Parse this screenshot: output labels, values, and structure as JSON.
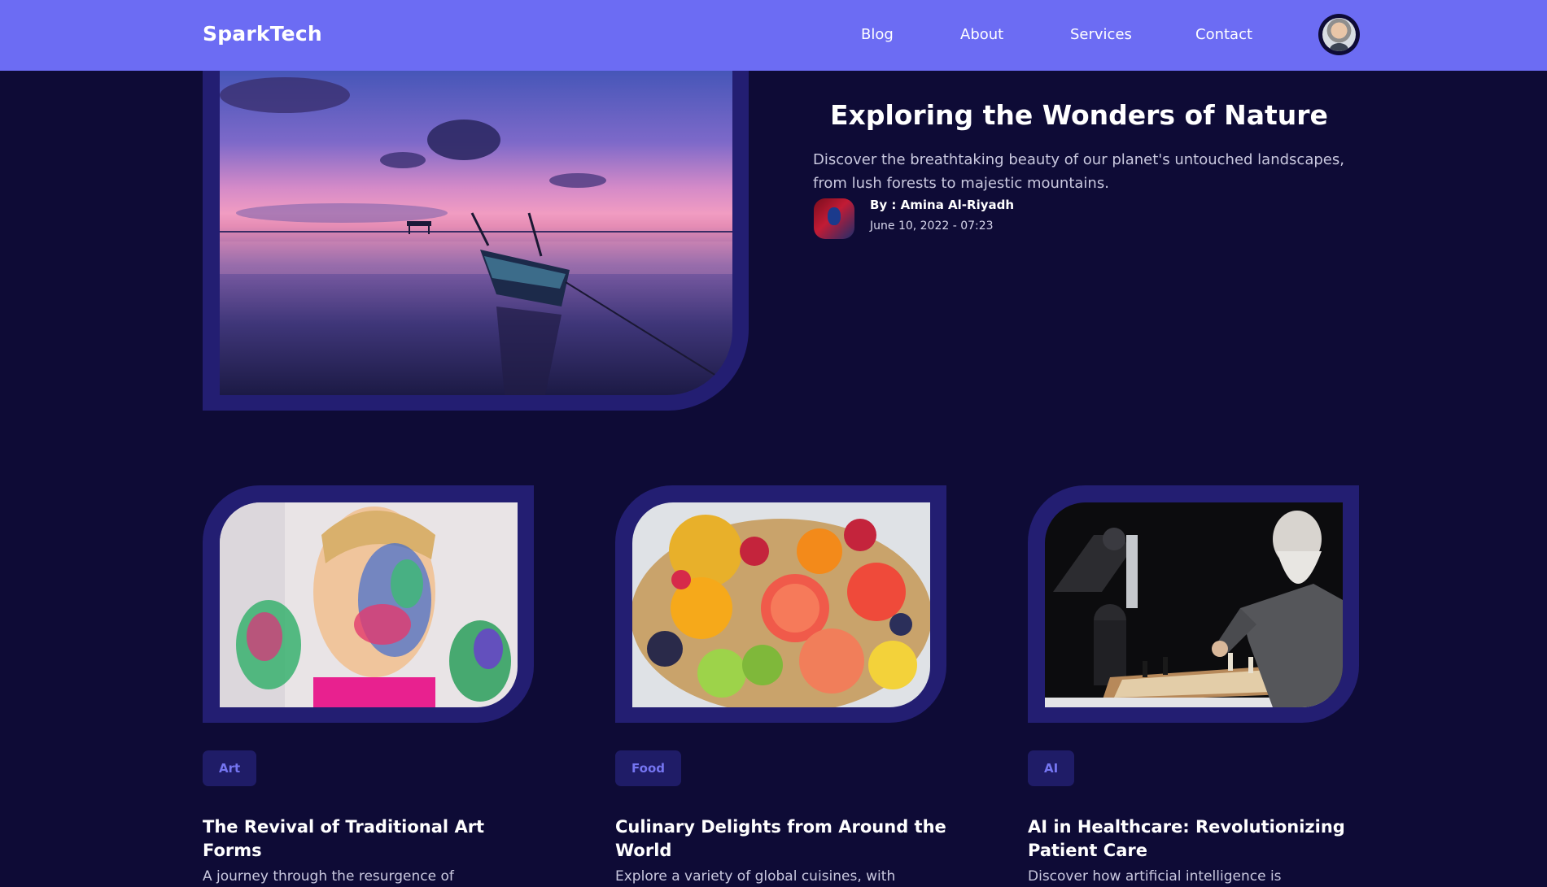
{
  "header": {
    "brand": "SparkTech",
    "nav": [
      "Blog",
      "About",
      "Services",
      "Contact"
    ],
    "profile_icon": "user-avatar"
  },
  "hero": {
    "title": "Exploring the Wonders of Nature",
    "description": "Discover the breathtaking beauty of our planet's untouched landscapes, from lush forests to majestic mountains.",
    "author": "By : Amina Al-Riyadh",
    "date": "June 10, 2022 - 07:23",
    "image": "sunset-lake-boat-photo"
  },
  "cards": [
    {
      "tag": "Art",
      "title": "The Revival of Traditional Art Forms",
      "excerpt": "A journey through the resurgence of",
      "image": "painted-face-child-photo"
    },
    {
      "tag": "Food",
      "title": "Culinary Delights from Around the World",
      "excerpt": "Explore a variety of global cuisines, with",
      "image": "fruit-platter-photo"
    },
    {
      "tag": "AI",
      "title": "AI in Healthcare: Revolutionizing Patient Care",
      "excerpt": "Discover how artificial intelligence is",
      "image": "robot-chess-photo"
    }
  ],
  "colors": {
    "background": "#0e0b36",
    "navbar": "#6c6cf3",
    "frame": "#231e72",
    "tag_text": "#7575f1"
  }
}
